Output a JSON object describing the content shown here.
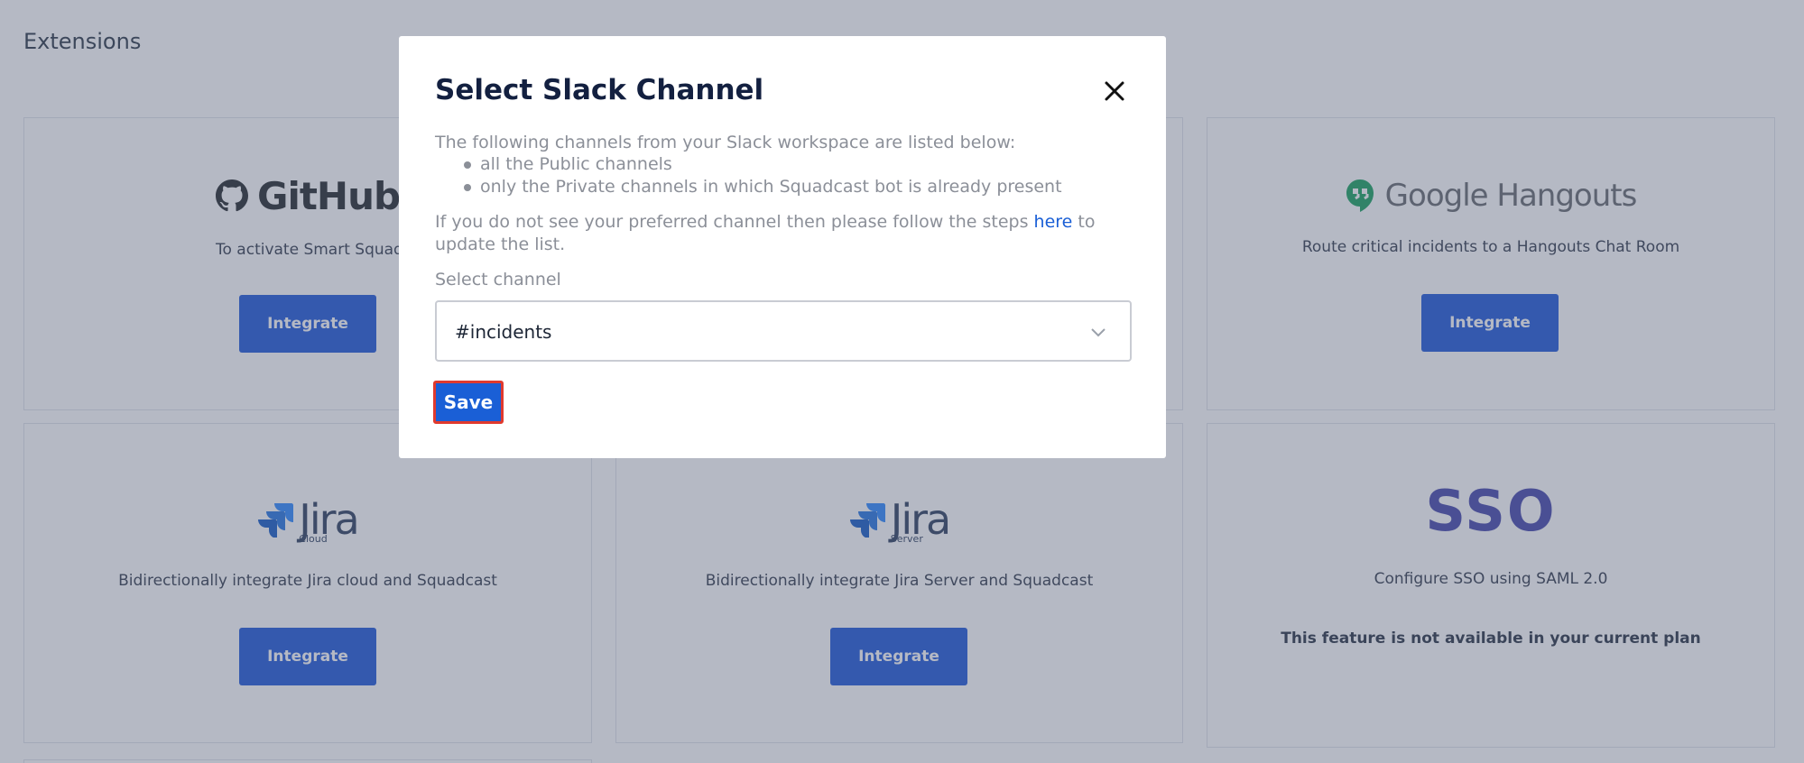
{
  "page": {
    "title": "Extensions"
  },
  "cards": {
    "github": {
      "desc": "To activate Smart Squads",
      "button": "Integrate"
    },
    "hangouts": {
      "logo_text": "Google Hangouts",
      "desc": "Route critical incidents to a Hangouts Chat Room",
      "button": "Integrate"
    },
    "jira_cloud": {
      "logo_text": "Jira",
      "logo_sub": "Cloud",
      "desc": "Bidirectionally integrate Jira cloud and Squadcast",
      "button": "Integrate"
    },
    "jira_server": {
      "logo_text": "Jira",
      "logo_sub": "Server",
      "desc": "Bidirectionally integrate Jira Server and Squadcast",
      "button": "Integrate"
    },
    "sso": {
      "logo_text": "SSO",
      "desc": "Configure SSO using SAML 2.0",
      "note": "This feature is not available in your current plan"
    }
  },
  "github_logo_text": "GitHub",
  "modal": {
    "title": "Select Slack Channel",
    "intro": "The following channels from your Slack workspace are listed below:",
    "list": [
      "all the Public channels",
      "only the Private channels in which Squadcast bot is already present"
    ],
    "help_prefix": "If you do not see your preferred channel then please follow the steps ",
    "help_link": "here",
    "help_suffix": " to update the list.",
    "select_label": "Select channel",
    "select_value": "#incidents",
    "save_label": "Save"
  },
  "colors": {
    "primary": "#1550d8",
    "link": "#1a5fd6",
    "highlight": "#e03a2e",
    "hangouts_green": "#0f9d58",
    "jira_blue": "#2684ff",
    "sso_purple": "#3d3fa8"
  },
  "icons": {
    "close": "close-icon",
    "chevron": "chevron-down-icon",
    "github": "github-icon",
    "hangouts": "hangouts-icon",
    "jira": "jira-icon"
  }
}
